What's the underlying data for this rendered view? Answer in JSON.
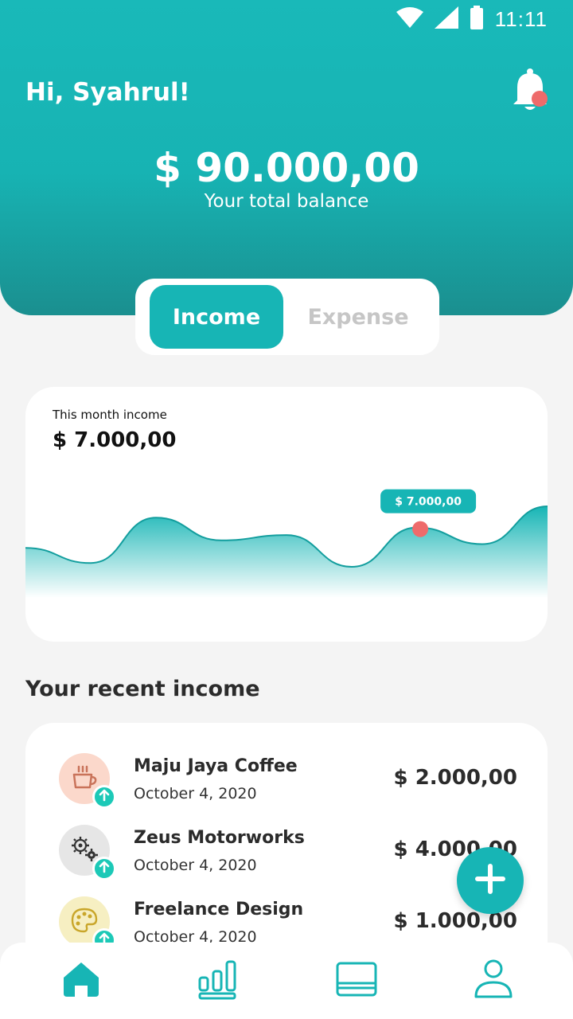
{
  "status_bar": {
    "time": "11:11",
    "icons": [
      "wifi-icon",
      "signal-icon",
      "battery-icon"
    ]
  },
  "header": {
    "greeting": "Hi, Syahrul!",
    "balance": "$ 90.000,00",
    "balance_label": "Your total balance",
    "notification_icon": "bell-icon"
  },
  "tabs": {
    "income": "Income",
    "expense": "Expense",
    "active": "income"
  },
  "chart_card": {
    "label": "This month income",
    "value": "$ 7.000,00",
    "tooltip": "$ 7.000,00"
  },
  "chart_data": {
    "type": "area",
    "title": "",
    "points": [
      0.45,
      0.25,
      0.85,
      0.55,
      0.62,
      0.2,
      0.72,
      0.5,
      1.0
    ],
    "highlight_index": 6,
    "highlight_label": "$ 7.000,00",
    "grid": false
  },
  "recent": {
    "title": "Your recent income",
    "items": [
      {
        "name": "Maju Jaya Coffee",
        "date": "October 4, 2020",
        "amount": "$ 2.000,00",
        "icon": "coffee-cup-icon",
        "icon_bg": "#fbd8cb"
      },
      {
        "name": "Zeus Motorworks",
        "date": "October 4, 2020",
        "amount": "$ 4.000,00",
        "icon": "gears-icon",
        "icon_bg": "#e6e6e6"
      },
      {
        "name": "Freelance Design",
        "date": "October 4, 2020",
        "amount": "$ 1.000,00",
        "icon": "palette-icon",
        "icon_bg": "#f6efc2"
      }
    ]
  },
  "fab": {
    "icon": "plus-icon"
  },
  "bottom_nav": {
    "items": [
      "home-icon",
      "stats-icon",
      "cards-icon",
      "profile-icon"
    ],
    "active": "home-icon"
  },
  "colors": {
    "primary": "#17b5b5",
    "accent": "#ee6b6b",
    "up_badge": "#1cc9b7"
  }
}
